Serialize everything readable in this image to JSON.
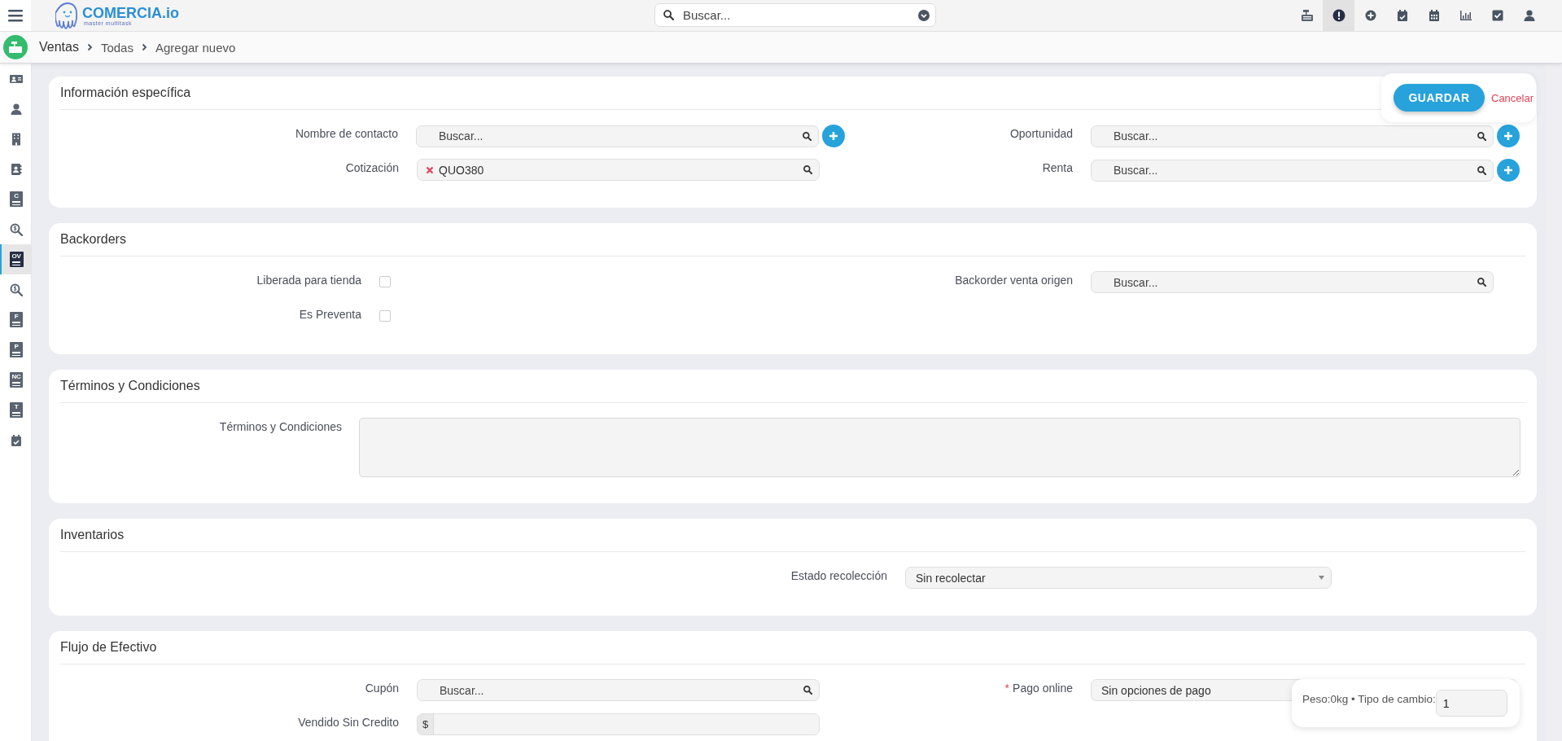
{
  "topbar": {
    "logo": {
      "name": "COMERCIA.io",
      "tagline": "master multitask"
    },
    "search": {
      "placeholder": "Buscar..."
    },
    "tools": [
      {
        "selected": false
      },
      {
        "selected": true
      },
      {
        "selected": false
      },
      {
        "selected": false
      },
      {
        "selected": false
      },
      {
        "selected": false
      },
      {
        "selected": false
      },
      {
        "selected": false
      }
    ]
  },
  "breadcrumb": [
    "Ventas",
    "Todas",
    "Agregar nuevo"
  ],
  "sidebar": [
    {
      "selected": false
    },
    {
      "selected": false
    },
    {
      "selected": false
    },
    {
      "selected": false
    },
    {
      "selected": false,
      "badge": "C"
    },
    {
      "selected": false
    },
    {
      "selected": true,
      "badge": "OV"
    },
    {
      "selected": false
    },
    {
      "selected": false,
      "badge": "F"
    },
    {
      "selected": false,
      "badge": "P"
    },
    {
      "selected": false,
      "badge": "NC"
    },
    {
      "selected": false,
      "badge": "T"
    },
    {
      "selected": false
    }
  ],
  "actions": {
    "save": "GUARDAR",
    "cancel": "Cancelar"
  },
  "sections": [
    {
      "title": "Información específica",
      "rows": [
        {
          "left": {
            "kind": "search",
            "label": "Nombre de contacto",
            "placeholder": "Buscar...",
            "add_button": true
          },
          "right": {
            "kind": "search",
            "label": "Oportunidad",
            "placeholder": "Buscar...",
            "add_button": true
          }
        },
        {
          "left": {
            "kind": "chip",
            "label": "Cotización",
            "value": "QUO380",
            "add_button": false
          },
          "right": {
            "kind": "search",
            "label": "Renta",
            "placeholder": "Buscar...",
            "add_button": true
          }
        }
      ]
    },
    {
      "title": "Backorders",
      "rows": [
        {
          "left": {
            "kind": "checkbox",
            "label": "Liberada para tienda",
            "checked": false
          },
          "right": {
            "kind": "search",
            "label": "Backorder venta origen",
            "placeholder": "Buscar...",
            "add_button": false
          }
        },
        {
          "left": {
            "kind": "checkbox",
            "label": "Es Preventa",
            "checked": false
          }
        }
      ]
    },
    {
      "title": "Términos y Condiciones",
      "rows": [
        {
          "left": {
            "kind": "textarea",
            "label": "Términos y Condiciones"
          }
        }
      ]
    },
    {
      "title": "Inventarios",
      "rows": [
        {
          "left": {
            "kind": "select",
            "label": "Estado recolección",
            "value": "Sin recolectar"
          }
        }
      ]
    },
    {
      "title": "Flujo de Efectivo",
      "rows": [
        {
          "left": {
            "kind": "search",
            "label": "Cupón",
            "placeholder": "Buscar...",
            "add_button": false
          },
          "right": {
            "kind": "select",
            "label": "Pago online",
            "value": "Sin opciones de pago",
            "required_mark": "*"
          }
        },
        {
          "left": {
            "kind": "currency",
            "label": "Vendido Sin Credito",
            "prefix": "$"
          }
        }
      ]
    }
  ],
  "summary": {
    "text": "Peso:0kg • Tipo de cambio:",
    "exchange_rate": "1"
  }
}
